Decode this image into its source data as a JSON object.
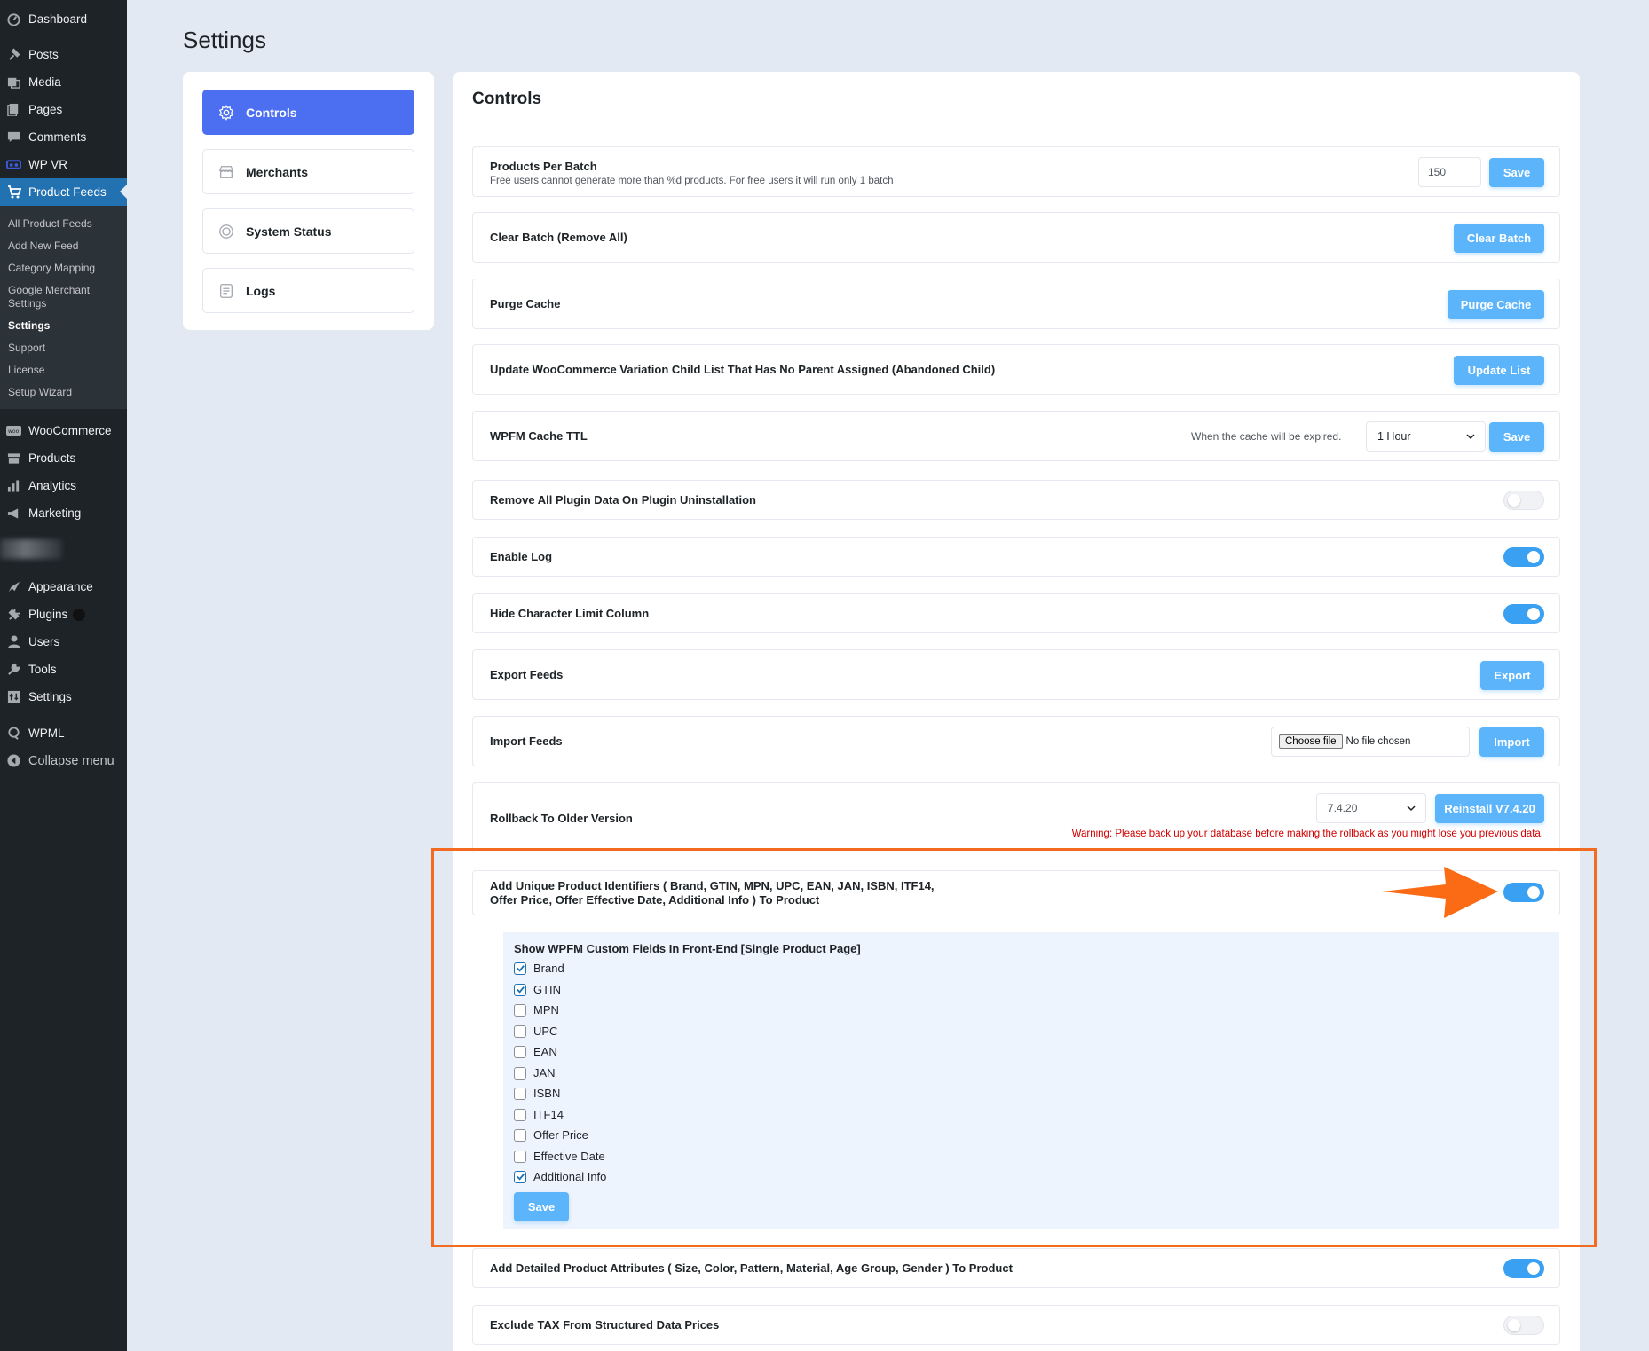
{
  "sidebar": {
    "top_items": [
      {
        "label": "Dashboard",
        "icon": "dashboard-icon"
      },
      {
        "label": "Posts",
        "icon": "pin-icon"
      },
      {
        "label": "Media",
        "icon": "media-icon"
      },
      {
        "label": "Pages",
        "icon": "pages-icon"
      },
      {
        "label": "Comments",
        "icon": "comments-icon"
      },
      {
        "label": "WP VR",
        "icon": "vr-icon"
      },
      {
        "label": "Product Feeds",
        "icon": "cart-icon"
      }
    ],
    "submenu": [
      {
        "label": "All Product Feeds"
      },
      {
        "label": "Add New Feed"
      },
      {
        "label": "Category Mapping"
      },
      {
        "label": "Google Merchant Settings"
      },
      {
        "label": "Settings"
      },
      {
        "label": "Support"
      },
      {
        "label": "License"
      },
      {
        "label": "Setup Wizard"
      }
    ],
    "mid_items": [
      {
        "label": "WooCommerce",
        "icon": "woo-icon"
      },
      {
        "label": "Products",
        "icon": "archive-icon"
      },
      {
        "label": "Analytics",
        "icon": "bar-chart-icon"
      },
      {
        "label": "Marketing",
        "icon": "megaphone-icon"
      }
    ],
    "bottom_items": [
      {
        "label": "Appearance",
        "icon": "brush-icon"
      },
      {
        "label": "Plugins",
        "icon": "plug-icon"
      },
      {
        "label": "Users",
        "icon": "user-icon"
      },
      {
        "label": "Tools",
        "icon": "wrench-icon"
      },
      {
        "label": "Settings",
        "icon": "settings-grid-icon"
      },
      {
        "label": "WPML",
        "icon": "wpml-icon"
      },
      {
        "label": "Collapse menu",
        "icon": "collapse-icon"
      }
    ]
  },
  "page": {
    "title": "Settings"
  },
  "tabs": [
    {
      "label": "Controls",
      "icon": "gear-icon"
    },
    {
      "label": "Merchants",
      "icon": "store-icon"
    },
    {
      "label": "System Status",
      "icon": "status-icon"
    },
    {
      "label": "Logs",
      "icon": "logs-icon"
    }
  ],
  "controls": {
    "title": "Controls",
    "products_per_batch": {
      "label": "Products Per Batch",
      "description": "Free users cannot generate more than %d products. For free users it will run only 1 batch",
      "value": "150",
      "button": "Save"
    },
    "clear_batch": {
      "label": "Clear Batch (Remove All)",
      "button": "Clear Batch"
    },
    "purge_cache": {
      "label": "Purge Cache",
      "button": "Purge Cache"
    },
    "update_list": {
      "label": "Update WooCommerce Variation Child List That Has No Parent Assigned (Abandoned Child)",
      "button": "Update List"
    },
    "cache_ttl": {
      "label": "WPFM Cache TTL",
      "hint": "When the cache will be expired.",
      "selected": "1 Hour",
      "button": "Save"
    },
    "remove_data": {
      "label": "Remove All Plugin Data On Plugin Uninstallation",
      "enabled": false
    },
    "enable_log": {
      "label": "Enable Log",
      "enabled": true
    },
    "hide_char_limit": {
      "label": "Hide Character Limit Column",
      "enabled": true
    },
    "export_feeds": {
      "label": "Export Feeds",
      "button": "Export"
    },
    "import_feeds": {
      "label": "Import Feeds",
      "file_button": "Choose file",
      "file_status": "No file chosen",
      "button": "Import"
    },
    "rollback": {
      "label": "Rollback To Older Version",
      "selected": "7.4.20",
      "button": "Reinstall V7.4.20",
      "warning": "Warning: Please back up your database before making the rollback as you might lose you previous data."
    },
    "unique_identifiers": {
      "label_line1": "Add Unique Product Identifiers ( Brand, GTIN, MPN, UPC, EAN, JAN, ISBN, ITF14,",
      "label_line2": "Offer Price, Offer Effective Date, Additional Info ) To Product",
      "enabled": true
    },
    "custom_fields": {
      "title": "Show WPFM Custom Fields In Front-End [Single Product Page]",
      "items": [
        {
          "label": "Brand",
          "checked": true
        },
        {
          "label": "GTIN",
          "checked": true
        },
        {
          "label": "MPN",
          "checked": false
        },
        {
          "label": "UPC",
          "checked": false
        },
        {
          "label": "EAN",
          "checked": false
        },
        {
          "label": "JAN",
          "checked": false
        },
        {
          "label": "ISBN",
          "checked": false
        },
        {
          "label": "ITF14",
          "checked": false
        },
        {
          "label": "Offer Price",
          "checked": false
        },
        {
          "label": "Effective Date",
          "checked": false
        },
        {
          "label": "Additional Info",
          "checked": true
        }
      ],
      "button": "Save"
    },
    "detailed_attributes": {
      "label": "Add Detailed Product Attributes ( Size, Color, Pattern, Material, Age Group, Gender ) To Product",
      "enabled": true
    },
    "exclude_tax": {
      "label": "Exclude TAX From Structured Data Prices",
      "enabled": false
    }
  },
  "colors": {
    "accent": "#4b6ff0",
    "button": "#5cb4fb",
    "toggle_on": "#3aa0f2",
    "highlight": "#f36b21",
    "warning": "#d20000"
  }
}
